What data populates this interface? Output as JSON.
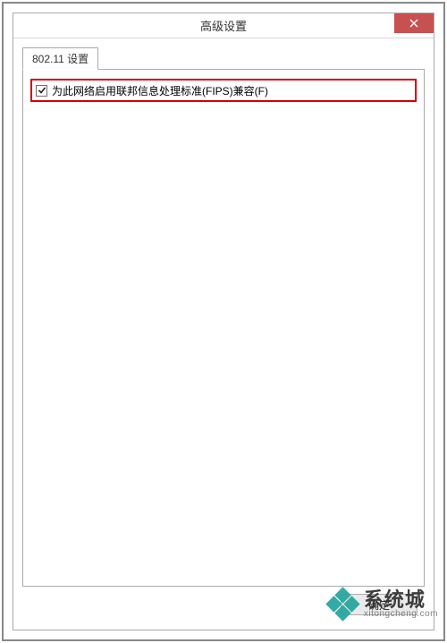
{
  "window": {
    "title": "高级设置",
    "close_icon": "close"
  },
  "tabs": [
    {
      "label": "802.11 设置"
    }
  ],
  "options": {
    "fips": {
      "checked": true,
      "label": "为此网络启用联邦信息处理标准(FIPS)兼容(F)"
    }
  },
  "buttons": {
    "ok": "确定"
  },
  "watermark": {
    "brand": "系统城",
    "url": "xitongcheng.com"
  }
}
